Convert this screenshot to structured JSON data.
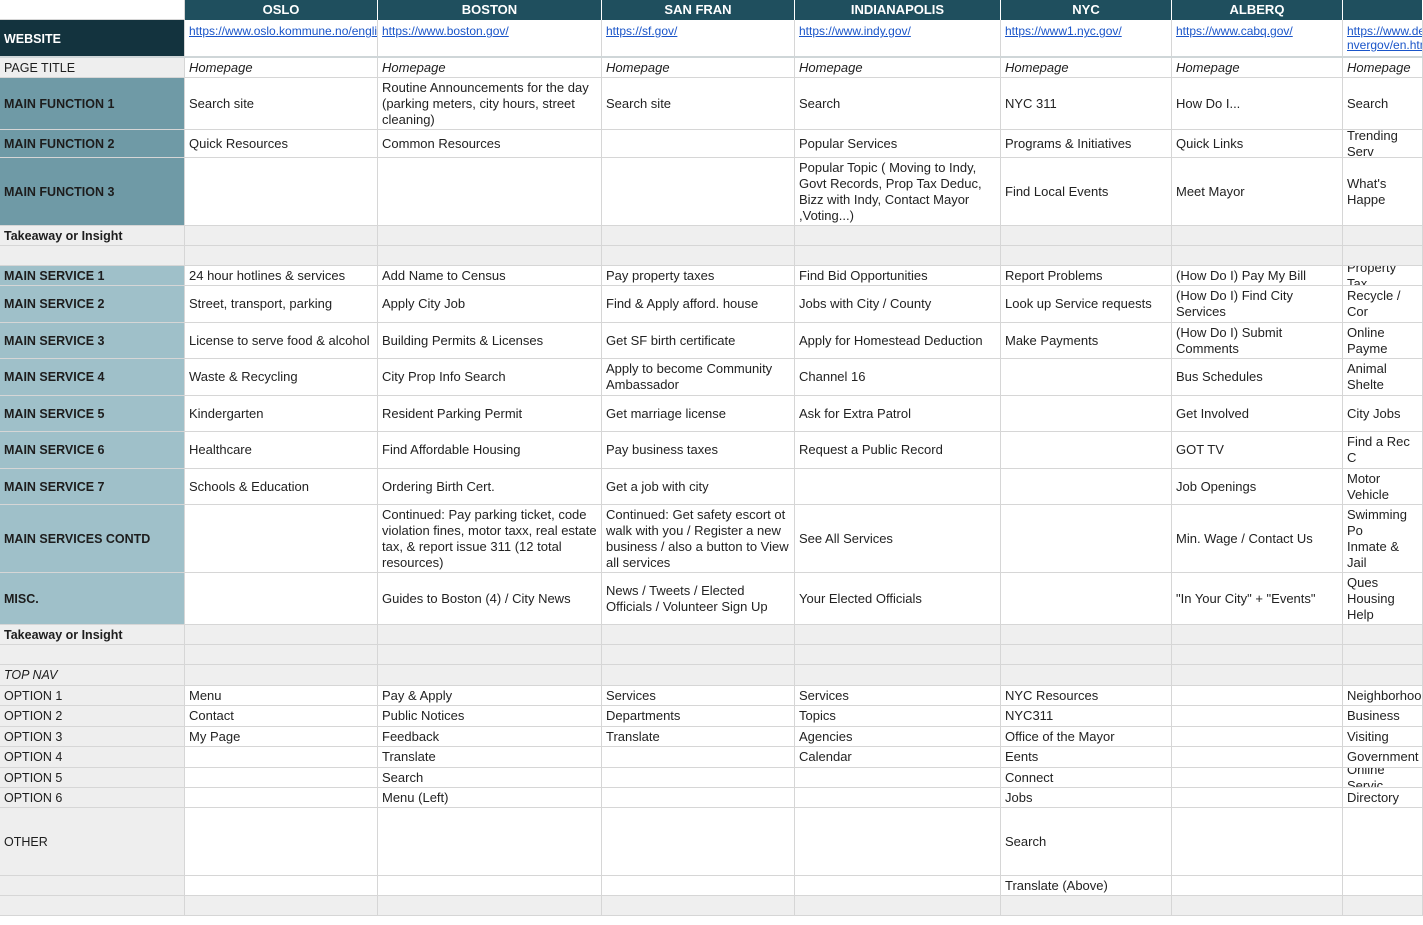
{
  "columns": [
    "OSLO",
    "BOSTON",
    "SAN FRAN",
    "INDIANAPOLIS",
    "NYC",
    "ALBERQ",
    ""
  ],
  "rows": [
    {
      "label": "WEBSITE",
      "kind": "web",
      "cellstyle": "link",
      "cells": [
        "https://www.oslo.kommune.no/english/#gref",
        "https://www.boston.gov/",
        "https://sf.gov/",
        "https://www.indy.gov/",
        "https://www1.nyc.gov/",
        "https://www.cabq.gov/",
        "https://www.de\nnvergov/en.htm"
      ]
    },
    {
      "label": "PAGE TITLE",
      "kind": "gray",
      "cellstyle": "italic",
      "cells": [
        "Homepage",
        "Homepage",
        "Homepage",
        "Homepage",
        "Homepage",
        "Homepage",
        "Homepage"
      ]
    },
    {
      "label": "MAIN FUNCTION 1",
      "kind": "func",
      "cells": [
        "Search site",
        "Routine Announcements for the day (parking meters, city hours, street cleaning)",
        "Search site",
        "Search",
        "NYC 311",
        "How Do I...",
        "Search"
      ]
    },
    {
      "label": "MAIN FUNCTION 2",
      "kind": "func",
      "cells": [
        "Quick Resources",
        "Common Resources",
        "",
        "Popular Services",
        "Programs & Initiatives",
        "Quick Links",
        "Trending Serv"
      ]
    },
    {
      "label": "MAIN FUNCTION 3",
      "kind": "func",
      "cells": [
        "",
        "",
        "",
        "Popular Topic ( Moving to Indy, Govt Records, Prop Tax Deduc, Bizz with Indy, Contact Mayor ,Voting...)",
        "Find Local Events",
        "Meet Mayor",
        "What's Happe"
      ]
    },
    {
      "label": "Takeaway or Insight",
      "kind": "ins",
      "cellstyle": "g",
      "cells": [
        "",
        "",
        "",
        "",
        "",
        "",
        ""
      ]
    },
    {
      "label": "",
      "kind": "gray",
      "cellstyle": "g",
      "cells": [
        "",
        "",
        "",
        "",
        "",
        "",
        ""
      ]
    },
    {
      "label": "MAIN SERVICE 1",
      "kind": "svc",
      "cells": [
        "24 hour hotlines & services",
        "Add Name to Census",
        "Pay property taxes",
        "Find Bid Opportunities",
        "Report Problems",
        "(How Do I) Pay My Bill",
        "Property Tax"
      ]
    },
    {
      "label": "MAIN SERVICE 2",
      "kind": "svc",
      "cells": [
        "Street, transport, parking",
        "Apply City Job",
        "Find & Apply afford. house",
        "Jobs with City / County",
        "Look up Service requests",
        "(How Do I) Find City Services",
        "Recycle / Cor"
      ]
    },
    {
      "label": "MAIN SERVICE 3",
      "kind": "svc",
      "cells": [
        "License to serve food & alcohol",
        "Building Permits & Licenses",
        "Get SF birth certificate",
        "Apply for Homestead Deduction",
        "Make Payments",
        "(How Do I) Submit Comments",
        "Online Payme"
      ]
    },
    {
      "label": "MAIN SERVICE 4",
      "kind": "svc",
      "cells": [
        "Waste & Recycling",
        "City Prop Info Search",
        "Apply to become Community Ambassador",
        "Channel 16",
        "",
        "Bus Schedules",
        "Animal Shelte"
      ]
    },
    {
      "label": "MAIN SERVICE 5",
      "kind": "svc",
      "cells": [
        "Kindergarten",
        "Resident Parking Permit",
        "Get marriage license",
        "Ask for Extra Patrol",
        "",
        "Get Involved",
        "City Jobs"
      ]
    },
    {
      "label": "MAIN SERVICE 6",
      "kind": "svc",
      "cells": [
        "Healthcare",
        "Find Affordable Housing",
        "Pay business taxes",
        "Request a Public Record",
        "",
        "GOT TV",
        "Find a Rec C"
      ]
    },
    {
      "label": "MAIN SERVICE 7",
      "kind": "svc",
      "cells": [
        "Schools & Education",
        "Ordering Birth Cert.",
        "Get a job with city",
        "",
        "",
        "Job Openings",
        "Motor Vehicle"
      ]
    },
    {
      "label": "MAIN SERVICES CONTD",
      "kind": "svc",
      "cells": [
        "",
        "Continued: Pay parking ticket, code violation fines, motor taxx, real estate tax, & report issue 311 (12 total resources)",
        "Continued: Get safety escort ot walk with you / Register a new business / also a button to View all services",
        "See All Services",
        "",
        "Min. Wage / Contact Us",
        "Swimming Po\nInmate & Jail"
      ]
    },
    {
      "label": "MISC.",
      "kind": "svc",
      "cells": [
        "",
        "Guides to Boston (4) / City News",
        "News / Tweets / Elected Officials / Volunteer Sign Up",
        "Your Elected Officials",
        "",
        "\"In Your City\" + \"Events\"",
        "Have A Ques\nHousing Help\nservices)"
      ]
    },
    {
      "label": "Takeaway or Insight",
      "kind": "ins",
      "cellstyle": "g",
      "cells": [
        "",
        "",
        "",
        "",
        "",
        "",
        ""
      ]
    },
    {
      "label": "",
      "kind": "gray",
      "cellstyle": "g",
      "cells": [
        "",
        "",
        "",
        "",
        "",
        "",
        ""
      ]
    },
    {
      "label": "TOP NAV",
      "kind": "nav",
      "cellstyle": "g",
      "cells": [
        "",
        "",
        "",
        "",
        "",
        "",
        ""
      ]
    },
    {
      "label": "OPTION 1",
      "kind": "opt",
      "cells": [
        "Menu",
        "Pay & Apply",
        "Services",
        "Services",
        "NYC Resources",
        "",
        "Neighborhoo"
      ]
    },
    {
      "label": "OPTION 2",
      "kind": "opt",
      "cells": [
        "Contact",
        "Public Notices",
        "Departments",
        "Topics",
        "NYC311",
        "",
        "Business"
      ]
    },
    {
      "label": "OPTION 3",
      "kind": "opt",
      "cells": [
        "My Page",
        "Feedback",
        "Translate",
        "Agencies",
        "Office of the Mayor",
        "",
        "Visiting"
      ]
    },
    {
      "label": "OPTION 4",
      "kind": "opt",
      "cells": [
        "",
        "Translate",
        "",
        "Calendar",
        "Eents",
        "",
        "Government"
      ]
    },
    {
      "label": "OPTION 5",
      "kind": "opt",
      "cells": [
        "",
        "Search",
        "",
        "",
        "Connect",
        "",
        "Online Servic"
      ]
    },
    {
      "label": "OPTION 6",
      "kind": "opt",
      "cells": [
        "",
        "Menu (Left)",
        "",
        "",
        "Jobs",
        "",
        "Directory"
      ]
    },
    {
      "label": "OTHER",
      "kind": "opt",
      "cells": [
        "",
        "",
        "",
        "",
        "Search",
        "",
        ""
      ]
    },
    {
      "label": "",
      "kind": "opt",
      "cells": [
        "",
        "",
        "",
        "",
        "Translate (Above)",
        "",
        ""
      ]
    },
    {
      "label": "",
      "kind": "gray",
      "cellstyle": "g",
      "cells": [
        "",
        "",
        "",
        "",
        "",
        "",
        ""
      ]
    }
  ]
}
